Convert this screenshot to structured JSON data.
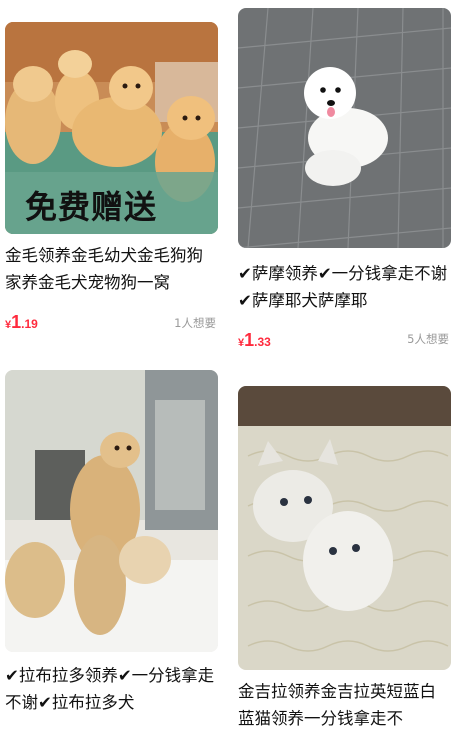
{
  "products": [
    {
      "image_overlay": "免费赠送",
      "title": "金毛领养金毛幼犬金毛狗狗家养金毛犬宠物狗一窝",
      "price_symbol": "¥",
      "price_int": "1",
      "price_dec": ".19",
      "wants": "1人想要"
    },
    {
      "title": "✔萨摩领养✔一分钱拿走不谢✔萨摩耶犬萨摩耶",
      "price_symbol": "¥",
      "price_int": "1",
      "price_dec": ".33",
      "wants": "5人想要"
    },
    {
      "title": "✔拉布拉多领养✔一分钱拿走不谢✔拉布拉多犬"
    },
    {
      "title": "金吉拉领养金吉拉英短蓝白蓝猫领养一分钱拿走不"
    }
  ]
}
